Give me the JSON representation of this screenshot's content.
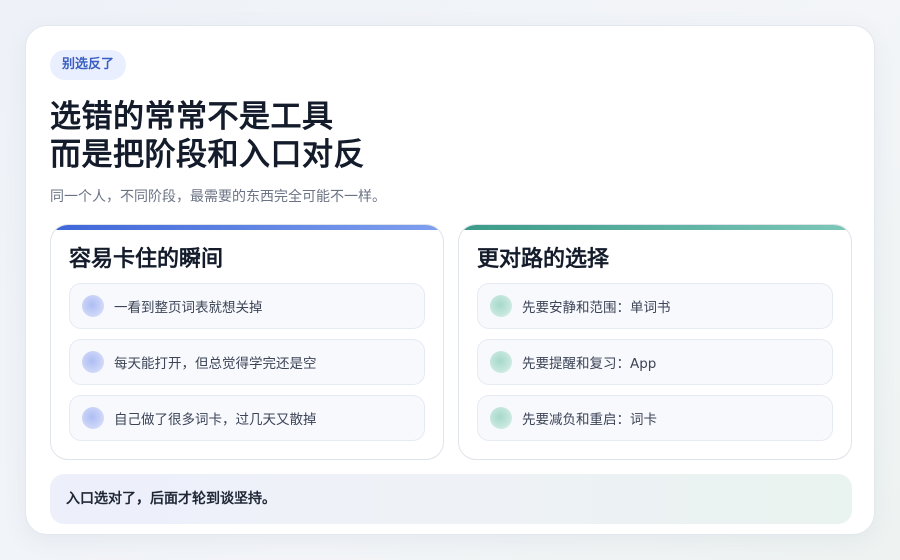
{
  "tag": "别选反了",
  "title": {
    "line1": "选错的常常不是工具",
    "line2": "而是把阶段和入口对反"
  },
  "subtitle": "同一个人，不同阶段，最需要的东西完全可能不一样。",
  "panels": {
    "left": {
      "title": "容易卡住的瞬间",
      "items": [
        "一看到整页词表就想关掉",
        "每天能打开，但总觉得学完还是空",
        "自己做了很多词卡，过几天又散掉"
      ]
    },
    "right": {
      "title": "更对路的选择",
      "items": [
        "先要安静和范围：单词书",
        "先要提醒和复习：App",
        "先要减负和重启：词卡"
      ]
    }
  },
  "footer": "入口选对了，后面才轮到谈坚持。",
  "colors": {
    "accent_blue": "#3f66d8",
    "accent_green": "#3a9a88",
    "title_text": "#141c2b"
  }
}
